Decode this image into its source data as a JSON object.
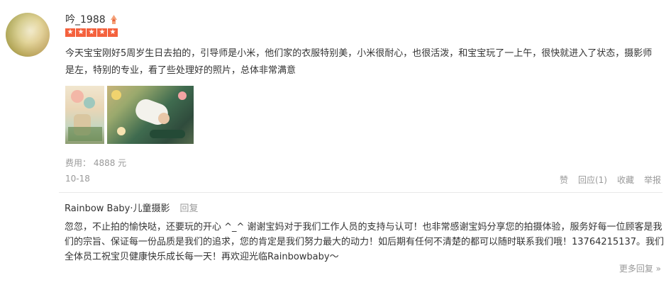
{
  "review": {
    "username": "吟_1988",
    "vip_icon": "vip-badge-icon",
    "rating_stars": 5,
    "star_icon": "star-icon",
    "accent_color": "#f4613d",
    "content": "今天宝宝刚好5周岁生日去拍的，引导师是小米，他们家的衣服特别美，小米很耐心，也很活泼，和宝宝玩了一上午，很快就进入了状态，摄影师是左，特别的专业，看了些处理好的照片，总体非常满意",
    "photo_count": 2,
    "price": "费用：  4888 元",
    "date": "10-18",
    "actions": {
      "like": "赞",
      "reply": "回应(1)",
      "favorite": "收藏",
      "report": "举报"
    }
  },
  "shop_reply": {
    "shop_name": "Rainbow Baby·儿童摄影",
    "reply_link": "回复",
    "text": "忽忽，不止拍的愉快哒，还要玩的开心 ^_^ 谢谢宝妈对于我们工作人员的支持与认可！也非常感谢宝妈分享您的拍摄体验，服务好每一位顾客是我们的宗旨、保证每一份品质是我们的追求，您的肯定是我们努力最大的动力！如后期有任何不清楚的都可以随时联系我们哦！13764215137。我们全体员工祝宝贝健康快乐成长每一天！再欢迎光临Rainbowbaby～",
    "more": "更多回复 »"
  }
}
